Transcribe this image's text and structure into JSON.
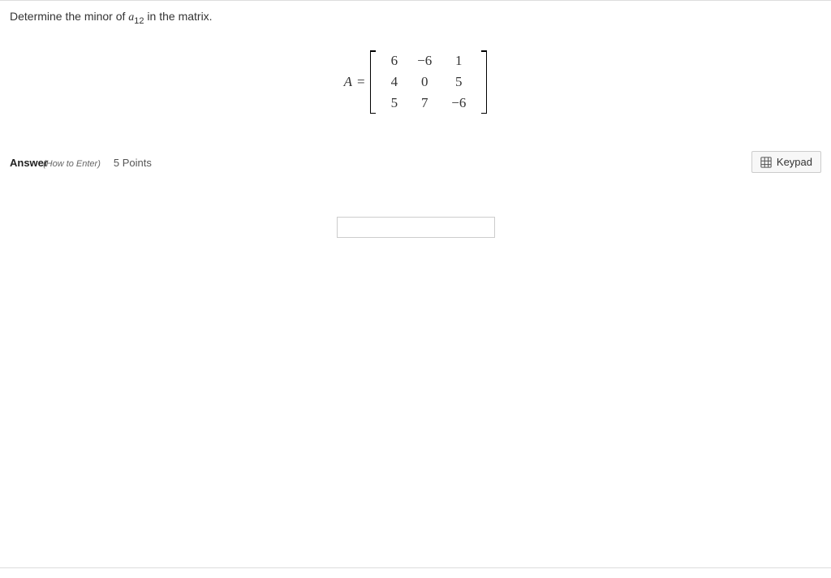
{
  "question": {
    "prompt_prefix": "Determine the minor of ",
    "variable_base": "a",
    "variable_sub": "12",
    "prompt_suffix": " in the matrix."
  },
  "matrix": {
    "lhs": "A",
    "eq": " = ",
    "rows": [
      [
        "6",
        "−6",
        "1"
      ],
      [
        "4",
        "0",
        "5"
      ],
      [
        "5",
        "7",
        "−6"
      ]
    ]
  },
  "answer_bar": {
    "label": "Answer",
    "how_to": "(How to Enter)",
    "points": "5 Points",
    "keypad": "Keypad"
  },
  "input": {
    "value": ""
  }
}
